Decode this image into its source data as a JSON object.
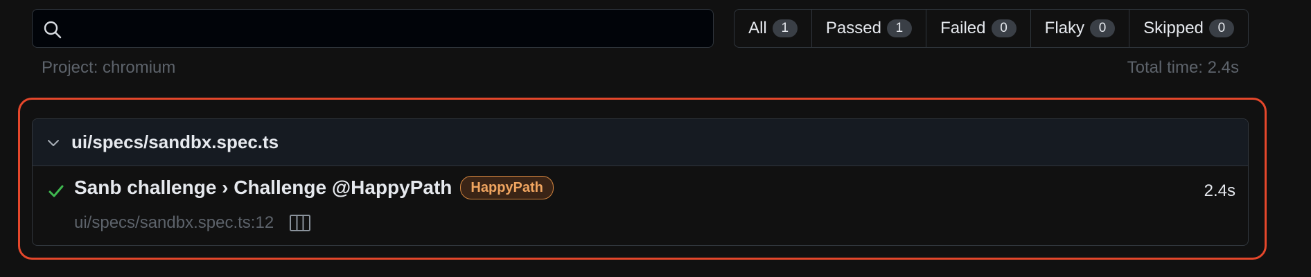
{
  "search": {
    "placeholder": "",
    "value": "",
    "icon": "search-icon"
  },
  "filters": [
    {
      "label": "All",
      "count": "1"
    },
    {
      "label": "Passed",
      "count": "1"
    },
    {
      "label": "Failed",
      "count": "0"
    },
    {
      "label": "Flaky",
      "count": "0"
    },
    {
      "label": "Skipped",
      "count": "0"
    }
  ],
  "meta": {
    "project": "Project: chromium",
    "total_time": "Total time: 2.4s"
  },
  "suite": {
    "title": "ui/specs/sandbx.spec.ts",
    "expand_icon": "chevron-down-icon",
    "tests": [
      {
        "status_icon": "check-icon",
        "title": "Sanb challenge › Challenge @HappyPath",
        "tag": "HappyPath",
        "duration": "2.4s",
        "location": "ui/specs/sandbx.spec.ts:12",
        "trace_icon": "columns-icon"
      }
    ]
  },
  "colors": {
    "background": "#111111",
    "highlight_border": "#e5472b",
    "pass_green": "#3fb950",
    "tag_text": "#f0a560"
  }
}
